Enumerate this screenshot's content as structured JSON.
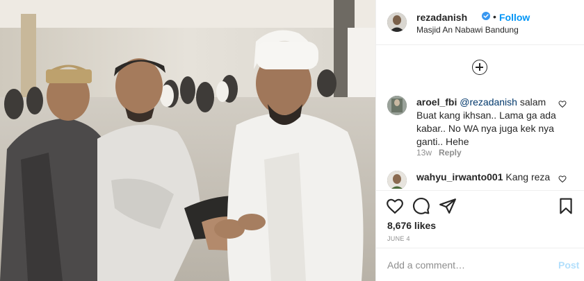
{
  "post": {
    "username": "rezadanish",
    "follow_label": "Follow",
    "separator": "•",
    "location": "Masjid An Nabawi Bandung",
    "photo_icon": "photo-of-three-men-in-mosque"
  },
  "comments": [
    {
      "username": "aroel_fbi",
      "mention": "@rezadanish",
      "text": "salam Buat kang ikhsan.. Lama ga ada kabar.. No WA nya juga kek nya ganti.. Hehe",
      "age": "13w",
      "reply_label": "Reply"
    },
    {
      "username": "wahyu_irwanto001",
      "text": "Kang reza"
    }
  ],
  "actions": {
    "likes": "8,676 likes",
    "date": "JUNE 4"
  },
  "comment_box": {
    "placeholder": "Add a comment…",
    "post_label": "Post"
  },
  "colors": {
    "accent": "#0095f6",
    "post_disabled": "#b2dffc",
    "mention": "#00376b"
  }
}
